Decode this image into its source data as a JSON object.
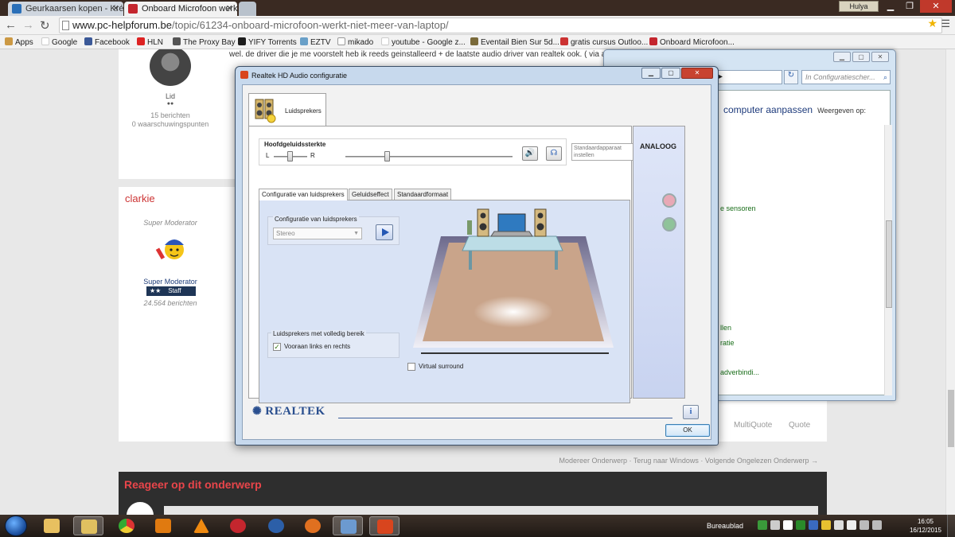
{
  "browser": {
    "tabs": [
      {
        "title": "Geurkaarsen kopen - Kréf"
      },
      {
        "title": "Onboard Microfoon werkt"
      }
    ],
    "user_badge": "Hulya",
    "url_domain": "www.pc-helpforum.be",
    "url_path": "/topic/61234-onboard-microfoon-werkt-niet-meer-van-laptop/",
    "bookmarks": [
      "Apps",
      "Google",
      "Facebook",
      "HLN",
      "The Proxy Bay",
      "YIFY Torrents",
      "EZTV",
      "mikado",
      "youtube - Google z...",
      "Eventail Bien Sur 5d...",
      "gratis cursus Outloo...",
      "Onboard Microfoon..."
    ]
  },
  "forum": {
    "top_text": "wel. de driver die je me voorstelt heb ik reeds geinstalleerd + de laatste audio driver van realtek ook. ( via a",
    "user1": {
      "role": "Lid",
      "dots": "●●",
      "posts": "15 berichten",
      "warnings": "0 waarschuwingspunten"
    },
    "user2": {
      "name": "clarkie",
      "role_top": "Super Moderator",
      "role": "Super Moderator",
      "badge_stars": "★★",
      "badge_label": "Staff",
      "posts": "24.564 berichten"
    },
    "actions": {
      "multiquote": "MultiQuote",
      "quote": "Quote"
    },
    "footer_links": "Modereer Onderwerp · Terug naar Windows · Volgende Ongelezen Onderwerp →",
    "reply_title": "Reageer op dit onderwerp"
  },
  "control_panel": {
    "address_tail": "ille ▸",
    "search_placeholder": "In Configuratiescher...",
    "heading": "computer aanpassen",
    "view_by": "Weergeven op:",
    "links": [
      "e sensoren",
      "llen",
      "ratie",
      "adverbindi..."
    ]
  },
  "realtek": {
    "title": "Realtek HD Audio configuratie",
    "device_tab": "Luidsprekers",
    "volume_title": "Hoofdgeluidssterkte",
    "left_label": "L",
    "right_label": "R",
    "balance_fraction": 0.5,
    "volume_fraction": 0.25,
    "default_device": "Standaardapparaat instellen",
    "side_label": "ANALOOG",
    "jack_colors": [
      "#e8a9b6",
      "#8fc39a"
    ],
    "subtabs": [
      "Configuratie van luidsprekers",
      "Geluidseffect",
      "Standaardformaat"
    ],
    "config_group_label": "Configuratie van luidsprekers",
    "config_value": "Stereo",
    "full_range_label": "Luidsprekers met volledig bereik",
    "front_lr_label": "Vooraan links en rechts",
    "front_lr_checked": true,
    "virtual_surround_label": "Virtual surround",
    "virtual_surround_checked": false,
    "brand": "REALTEK",
    "info": "i",
    "ok_label": "OK"
  },
  "taskbar": {
    "desktop_label": "Bureaublad",
    "time": "16:05",
    "date": "16/12/2015"
  }
}
